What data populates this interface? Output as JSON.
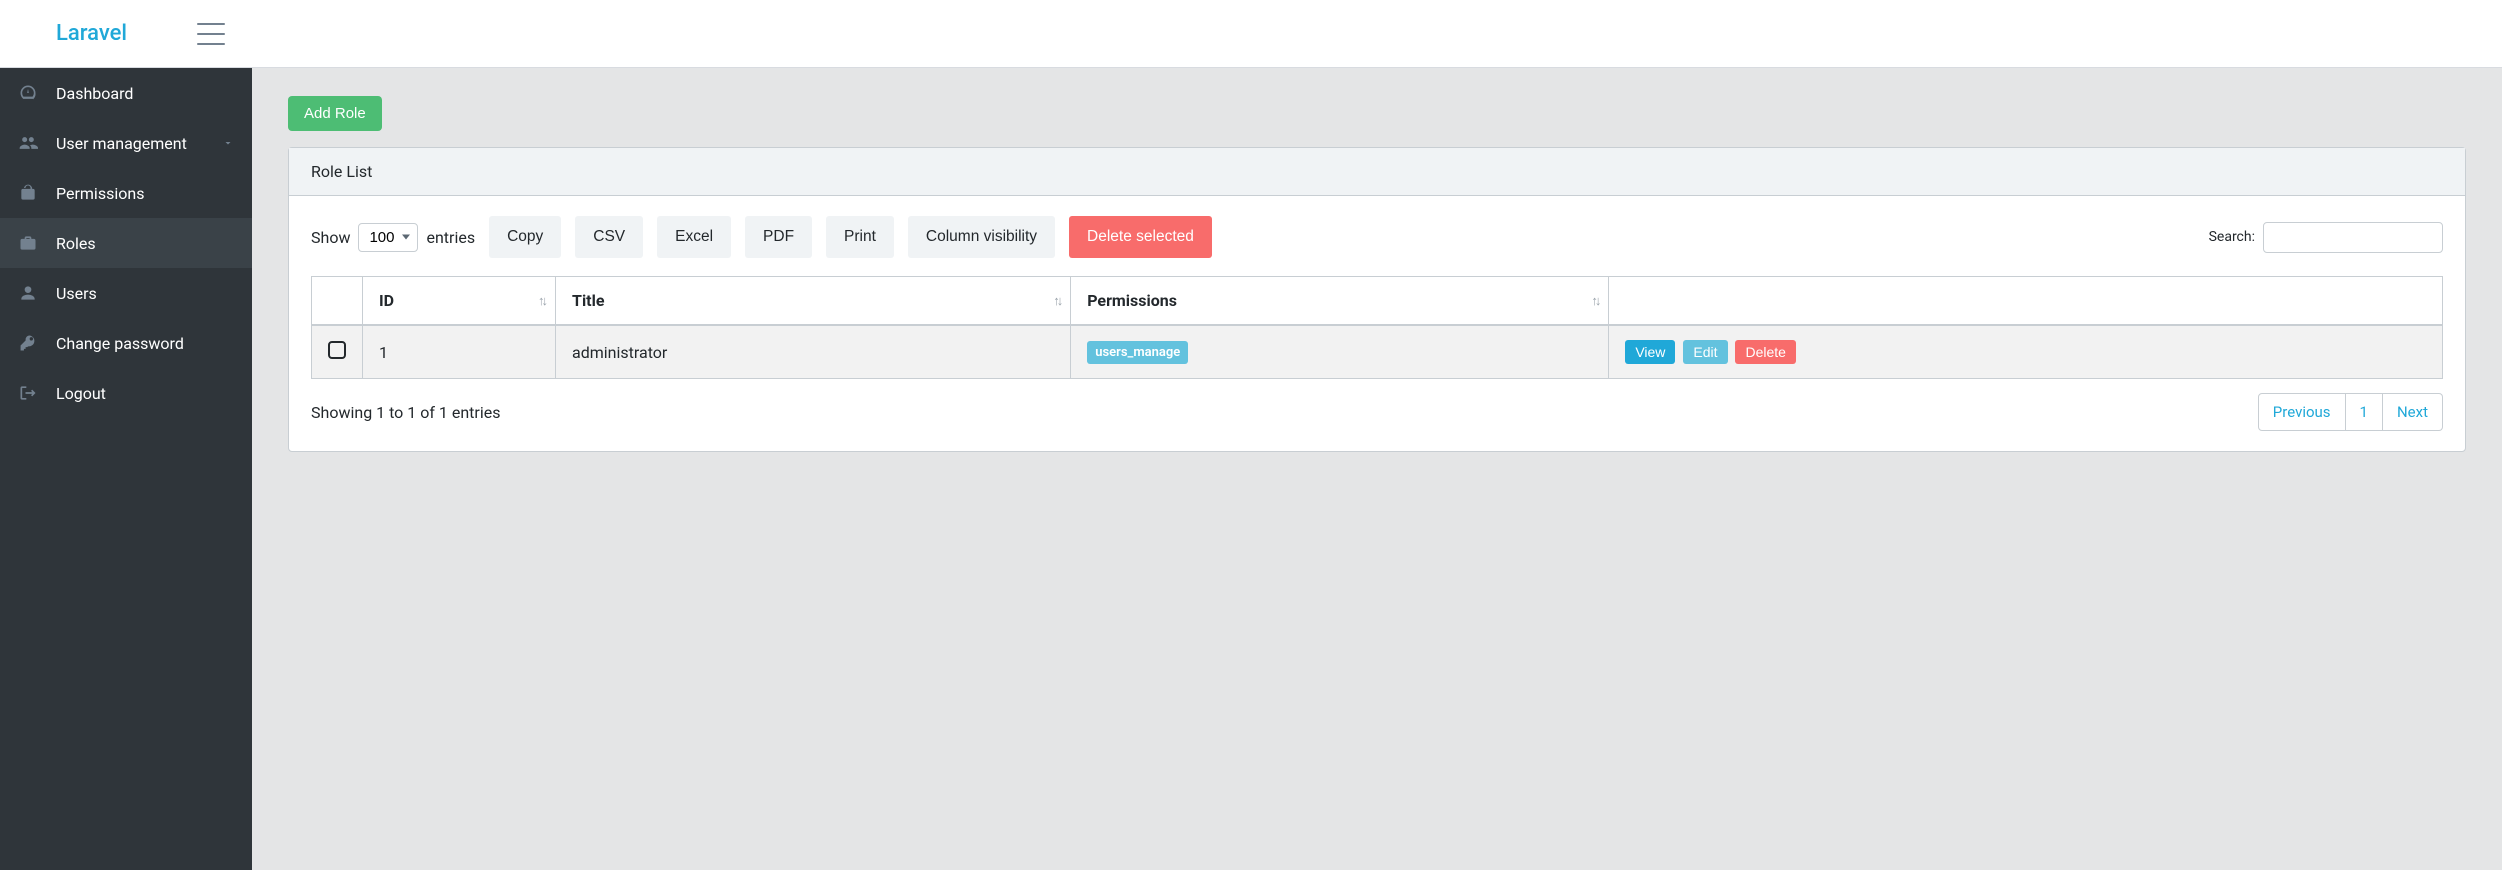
{
  "brand": "Laravel",
  "sidebar": {
    "items": [
      {
        "label": "Dashboard",
        "icon": "gauge-icon"
      },
      {
        "label": "User management",
        "icon": "users-icon",
        "expandable": true
      },
      {
        "label": "Permissions",
        "icon": "unlock-icon"
      },
      {
        "label": "Roles",
        "icon": "briefcase-icon",
        "active": true
      },
      {
        "label": "Users",
        "icon": "user-icon"
      },
      {
        "label": "Change password",
        "icon": "key-icon"
      },
      {
        "label": "Logout",
        "icon": "logout-icon"
      }
    ]
  },
  "main": {
    "add_button": "Add Role",
    "card_title": "Role List",
    "length": {
      "show": "Show",
      "value": "100",
      "entries": "entries"
    },
    "buttons": {
      "copy": "Copy",
      "csv": "CSV",
      "excel": "Excel",
      "pdf": "PDF",
      "print": "Print",
      "colvis": "Column visibility",
      "delete_selected": "Delete selected"
    },
    "search_label": "Search:",
    "columns": {
      "id": "ID",
      "title": "Title",
      "permissions": "Permissions"
    },
    "rows": [
      {
        "id": "1",
        "title": "administrator",
        "permissions": [
          "users_manage"
        ]
      }
    ],
    "row_actions": {
      "view": "View",
      "edit": "Edit",
      "delete": "Delete"
    },
    "info": "Showing 1 to 1 of 1 entries",
    "pagination": {
      "previous": "Previous",
      "page": "1",
      "next": "Next"
    }
  }
}
